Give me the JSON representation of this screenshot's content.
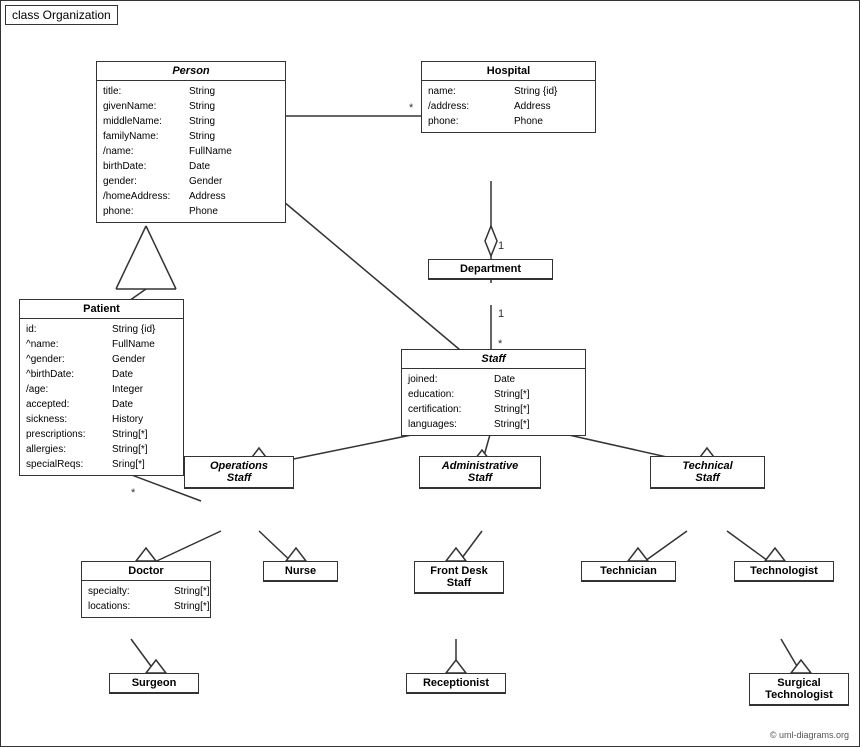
{
  "diagram": {
    "title": "class Organization",
    "copyright": "© uml-diagrams.org"
  },
  "classes": {
    "person": {
      "title": "Person",
      "italic": true,
      "attrs": [
        {
          "name": "title:",
          "type": "String"
        },
        {
          "name": "givenName:",
          "type": "String"
        },
        {
          "name": "middleName:",
          "type": "String"
        },
        {
          "name": "familyName:",
          "type": "String"
        },
        {
          "name": "/name:",
          "type": "FullName"
        },
        {
          "name": "birthDate:",
          "type": "Date"
        },
        {
          "name": "gender:",
          "type": "Gender"
        },
        {
          "name": "/homeAddress:",
          "type": "Address"
        },
        {
          "name": "phone:",
          "type": "Phone"
        }
      ]
    },
    "hospital": {
      "title": "Hospital",
      "attrs": [
        {
          "name": "name:",
          "type": "String {id}"
        },
        {
          "name": "/address:",
          "type": "Address"
        },
        {
          "name": "phone:",
          "type": "Phone"
        }
      ]
    },
    "patient": {
      "title": "Patient",
      "attrs": [
        {
          "name": "id:",
          "type": "String {id}"
        },
        {
          "name": "^name:",
          "type": "FullName"
        },
        {
          "name": "^gender:",
          "type": "Gender"
        },
        {
          "name": "^birthDate:",
          "type": "Date"
        },
        {
          "name": "/age:",
          "type": "Integer"
        },
        {
          "name": "accepted:",
          "type": "Date"
        },
        {
          "name": "sickness:",
          "type": "History"
        },
        {
          "name": "prescriptions:",
          "type": "String[*]"
        },
        {
          "name": "allergies:",
          "type": "String[*]"
        },
        {
          "name": "specialReqs:",
          "type": "Sring[*]"
        }
      ]
    },
    "department": {
      "title": "Department",
      "attrs": []
    },
    "staff": {
      "title": "Staff",
      "italic": true,
      "attrs": [
        {
          "name": "joined:",
          "type": "Date"
        },
        {
          "name": "education:",
          "type": "String[*]"
        },
        {
          "name": "certification:",
          "type": "String[*]"
        },
        {
          "name": "languages:",
          "type": "String[*]"
        }
      ]
    },
    "ops_staff": {
      "title": "Operations Staff",
      "italic": true
    },
    "admin_staff": {
      "title": "Administrative Staff",
      "italic": true
    },
    "tech_staff": {
      "title": "Technical Staff",
      "italic": true
    },
    "doctor": {
      "title": "Doctor",
      "attrs": [
        {
          "name": "specialty:",
          "type": "String[*]"
        },
        {
          "name": "locations:",
          "type": "String[*]"
        }
      ]
    },
    "nurse": {
      "title": "Nurse",
      "attrs": []
    },
    "front_desk": {
      "title": "Front Desk Staff",
      "attrs": []
    },
    "technician": {
      "title": "Technician",
      "attrs": []
    },
    "technologist": {
      "title": "Technologist",
      "attrs": []
    },
    "surgeon": {
      "title": "Surgeon",
      "attrs": []
    },
    "receptionist": {
      "title": "Receptionist",
      "attrs": []
    },
    "surgical_tech": {
      "title": "Surgical Technologist",
      "attrs": []
    }
  }
}
